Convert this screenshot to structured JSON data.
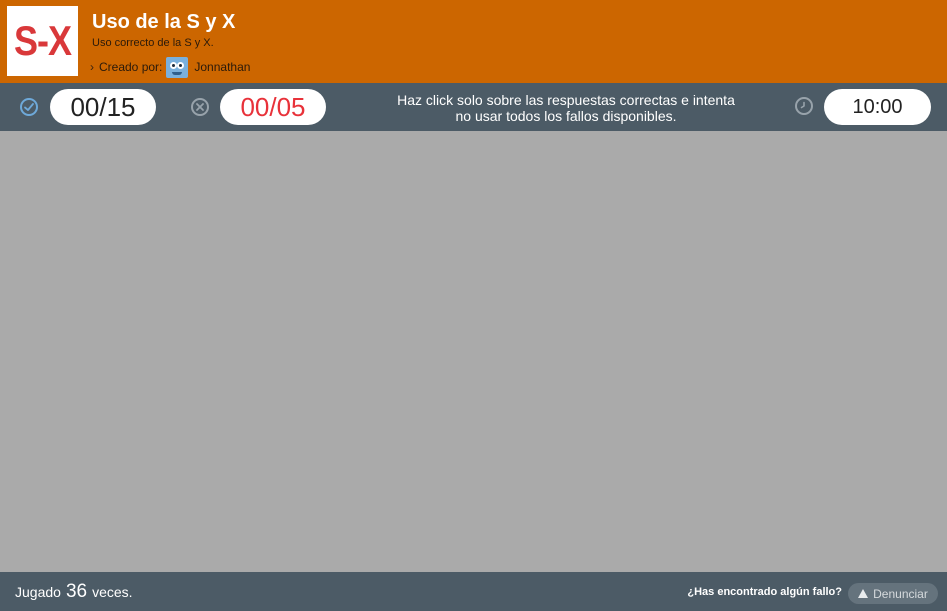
{
  "header": {
    "logo_text": "S-X",
    "title": "Uso de la S y X",
    "subtitle": "Uso correcto de la S y X.",
    "creator_label": "Creado por:",
    "creator_name": "Jonnathan"
  },
  "toolbar": {
    "correct_count": "00/15",
    "fail_count": "00/05",
    "instructions_line1": "Haz click solo sobre las respuestas correctas e intenta",
    "instructions_line2": "no usar todos los fallos disponibles.",
    "timer": "10:00"
  },
  "footer": {
    "played_prefix": "Jugado",
    "played_count": "36",
    "played_suffix": "veces.",
    "report_question": "¿Has encontrado algún fallo?",
    "report_button": "Denunciar"
  },
  "colors": {
    "header_bg": "#cc6600",
    "bar_bg": "#4c5b66",
    "content_bg": "#aaaaaa",
    "fail_text": "#e8323a",
    "check_accent": "#6ea9d9"
  },
  "icons": [
    "check-circle-icon",
    "x-circle-icon",
    "clock-icon",
    "chevron-right-icon",
    "warning-icon"
  ]
}
